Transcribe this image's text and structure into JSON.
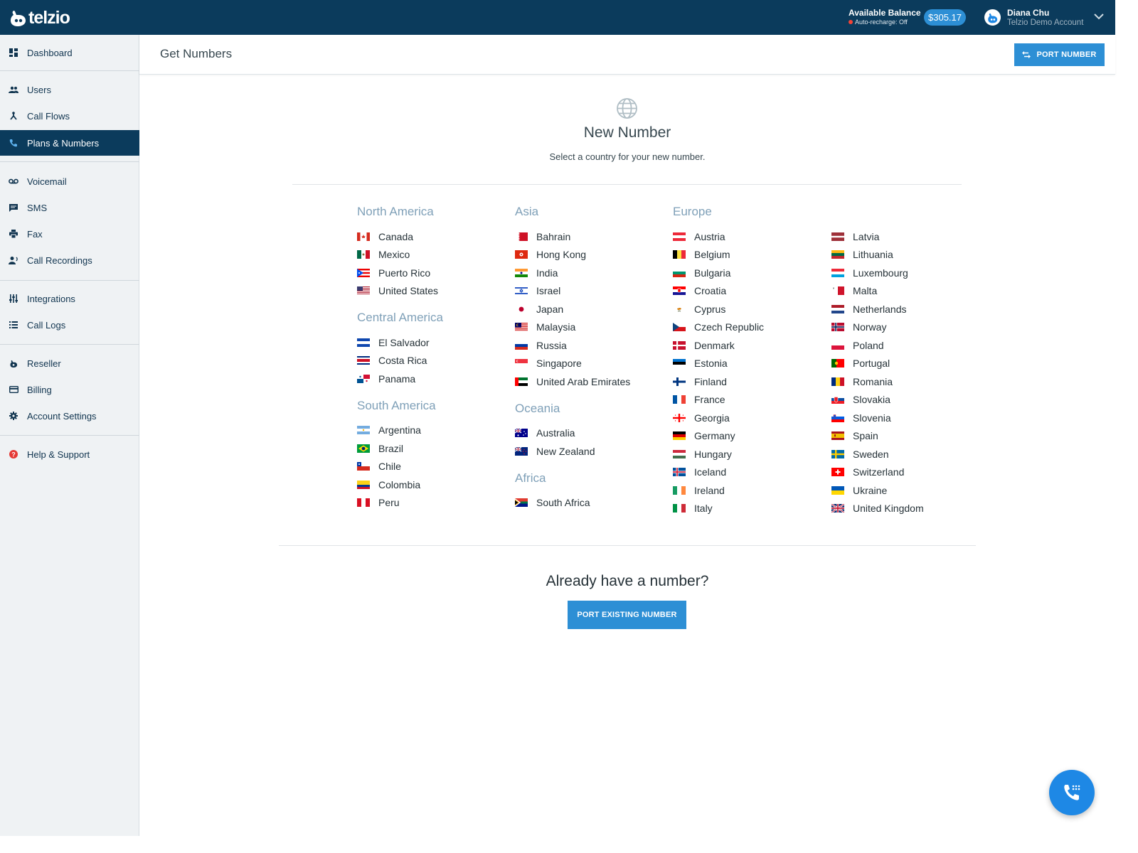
{
  "topbar": {
    "logo_text": "telzio",
    "balance_title": "Available Balance",
    "auto_recharge": "Auto-recharge: Off",
    "balance_amount": "$305.17",
    "user_name": "Diana Chu",
    "account_name": "Telzio Demo Account"
  },
  "sidebar": {
    "items": [
      {
        "label": "Dashboard",
        "icon": "dashboard-icon"
      },
      {
        "label": "Users",
        "icon": "users-icon"
      },
      {
        "label": "Call Flows",
        "icon": "call-flows-icon"
      },
      {
        "label": "Plans & Numbers",
        "icon": "phone-icon",
        "active": true
      },
      {
        "label": "Voicemail",
        "icon": "voicemail-icon"
      },
      {
        "label": "SMS",
        "icon": "sms-icon"
      },
      {
        "label": "Fax",
        "icon": "fax-icon"
      },
      {
        "label": "Call Recordings",
        "icon": "call-recordings-icon"
      },
      {
        "label": "Integrations",
        "icon": "integrations-icon"
      },
      {
        "label": "Call Logs",
        "icon": "call-logs-icon"
      },
      {
        "label": "Reseller",
        "icon": "reseller-icon"
      },
      {
        "label": "Billing",
        "icon": "billing-icon"
      },
      {
        "label": "Account Settings",
        "icon": "gear-icon"
      },
      {
        "label": "Help & Support",
        "icon": "help-icon"
      }
    ]
  },
  "header": {
    "title": "Get Numbers",
    "port_button": "PORT NUMBER"
  },
  "main": {
    "title": "New Number",
    "subtitle": "Select a country for your new number.",
    "columns": [
      {
        "groups": [
          {
            "region": "North America",
            "countries": [
              "Canada",
              "Mexico",
              "Puerto Rico",
              "United States"
            ]
          },
          {
            "region": "Central America",
            "countries": [
              "El Salvador",
              "Costa Rica",
              "Panama"
            ]
          },
          {
            "region": "South America",
            "countries": [
              "Argentina",
              "Brazil",
              "Chile",
              "Colombia",
              "Peru"
            ]
          }
        ]
      },
      {
        "groups": [
          {
            "region": "Asia",
            "countries": [
              "Bahrain",
              "Hong Kong",
              "India",
              "Israel",
              "Japan",
              "Malaysia",
              "Russia",
              "Singapore",
              "United Arab Emirates"
            ]
          },
          {
            "region": "Oceania",
            "countries": [
              "Australia",
              "New Zealand"
            ]
          },
          {
            "region": "Africa",
            "countries": [
              "South Africa"
            ]
          }
        ]
      },
      {
        "groups": [
          {
            "region": "Europe",
            "countries": [
              "Austria",
              "Belgium",
              "Bulgaria",
              "Croatia",
              "Cyprus",
              "Czech Republic",
              "Denmark",
              "Estonia",
              "Finland",
              "France",
              "Georgia",
              "Germany",
              "Hungary",
              "Iceland",
              "Ireland",
              "Italy"
            ]
          }
        ]
      },
      {
        "groups": [
          {
            "region": "",
            "countries": [
              "Latvia",
              "Lithuania",
              "Luxembourg",
              "Malta",
              "Netherlands",
              "Norway",
              "Poland",
              "Portugal",
              "Romania",
              "Slovakia",
              "Slovenia",
              "Spain",
              "Sweden",
              "Switzerland",
              "Ukraine",
              "United Kingdom"
            ]
          }
        ]
      }
    ],
    "already_title": "Already have a number?",
    "port_existing_button": "PORT EXISTING NUMBER"
  },
  "colors": {
    "topbar": "#0b3b5c",
    "accent": "#2d8fd5",
    "region": "#7fa0b8",
    "fab": "#1e88e5"
  }
}
